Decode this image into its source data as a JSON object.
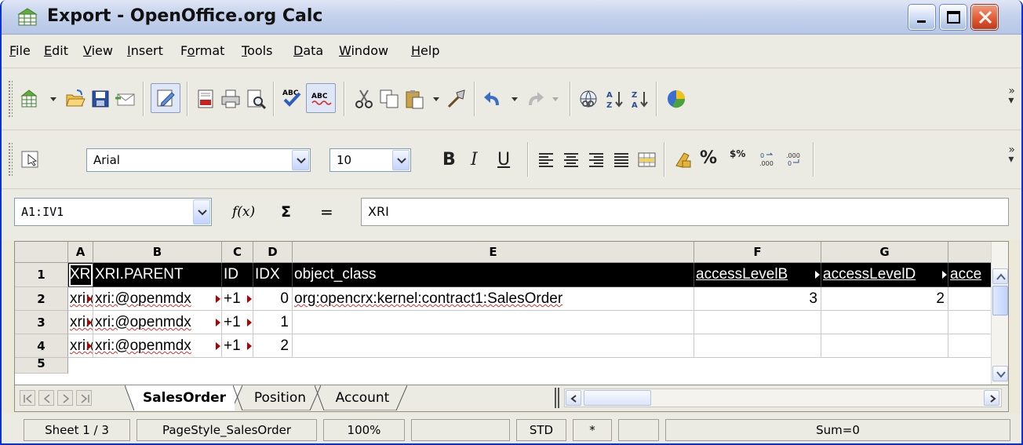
{
  "window": {
    "title": "Export - OpenOffice.org Calc"
  },
  "menu": [
    "File",
    "Edit",
    "View",
    "Insert",
    "Format",
    "Tools",
    "Data",
    "Window",
    "Help"
  ],
  "menu_underline": [
    "F",
    "E",
    "V",
    "I",
    "o",
    "T",
    "D",
    "W",
    "H"
  ],
  "toolbar_standard": {
    "icons": [
      "new-document-icon",
      "open-folder-icon",
      "save-icon",
      "email-icon",
      "edit-file-icon",
      "export-pdf-icon",
      "print-icon",
      "page-preview-icon",
      "spellcheck-icon",
      "autospellcheck-icon",
      "cut-icon",
      "copy-icon",
      "paste-icon",
      "clone-formatting-icon",
      "undo-icon",
      "redo-icon",
      "hyperlink-icon",
      "sort-ascending-icon",
      "sort-descending-icon",
      "chart-icon"
    ]
  },
  "toolbar_format": {
    "font_name": "Arial",
    "font_size": "10",
    "bold": "B",
    "italic": "I",
    "underline": "U",
    "percent": "%",
    "currency": "$%"
  },
  "formula": {
    "name_box": "A1:IV1",
    "fx": "f(x)",
    "sum": "Σ",
    "equals": "=",
    "content": "XRI"
  },
  "sheet": {
    "columns": [
      "A",
      "B",
      "C",
      "D",
      "E",
      "F",
      "G",
      ""
    ],
    "rows": [
      "1",
      "2",
      "3",
      "4",
      "5"
    ],
    "cells": [
      [
        "XRI",
        "XRI.PARENT",
        "ID",
        "IDX",
        "object_class",
        "accessLevelB",
        "accessLevelD",
        "acce"
      ],
      [
        "xri:@",
        "xri:@openmdx",
        "+1",
        "0",
        "org:opencrx:kernel:contract1:SalesOrder",
        "3",
        "2",
        ""
      ],
      [
        "xri:@",
        "xri:@openmdx",
        "+1",
        "1",
        "",
        "",
        "",
        ""
      ],
      [
        "xri:@",
        "xri:@openmdx",
        "+1",
        "2",
        "",
        "",
        "",
        ""
      ]
    ]
  },
  "tabs": [
    "SalesOrder",
    "Position",
    "Account"
  ],
  "active_tab": "SalesOrder",
  "status": {
    "sheet": "Sheet 1 / 3",
    "page_style": "PageStyle_SalesOrder",
    "zoom": "100%",
    "mode": "STD",
    "modified": "*",
    "sum": "Sum=0"
  },
  "colors": {
    "title_gradient": "#c5d2ec",
    "close_button": "#e35a35",
    "selection": "#000000"
  }
}
